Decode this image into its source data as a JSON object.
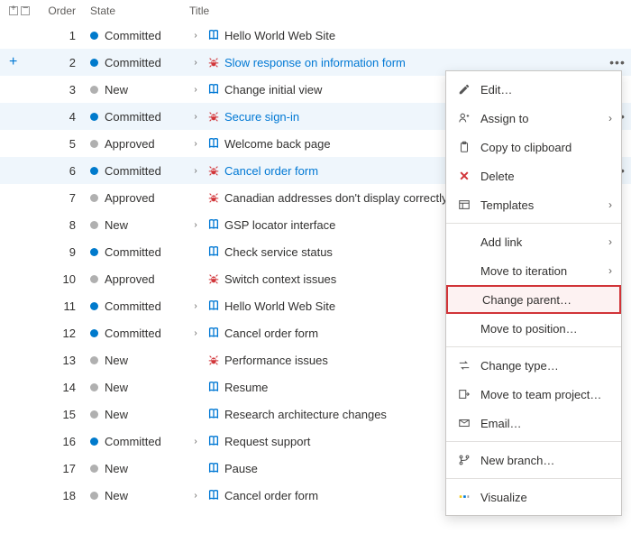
{
  "columns": {
    "order": "Order",
    "state": "State",
    "title": "Title"
  },
  "rows": [
    {
      "order": 1,
      "state": "Committed",
      "dot": "committed",
      "chev": true,
      "icon": "book",
      "title": "Hello World Web Site",
      "link": false,
      "sel": false,
      "dots": false
    },
    {
      "order": 2,
      "state": "Committed",
      "dot": "committed",
      "chev": true,
      "icon": "bug",
      "title": "Slow response on information form",
      "link": true,
      "sel": true,
      "dots": true,
      "add": true
    },
    {
      "order": 3,
      "state": "New",
      "dot": "new",
      "chev": true,
      "icon": "book",
      "title": "Change initial view",
      "link": false,
      "sel": false,
      "dots": false
    },
    {
      "order": 4,
      "state": "Committed",
      "dot": "committed",
      "chev": true,
      "icon": "bug",
      "title": "Secure sign-in",
      "link": true,
      "sel": true,
      "dots": true
    },
    {
      "order": 5,
      "state": "Approved",
      "dot": "approved",
      "chev": true,
      "icon": "book",
      "title": "Welcome back page",
      "link": false,
      "sel": false,
      "dots": false
    },
    {
      "order": 6,
      "state": "Committed",
      "dot": "committed",
      "chev": true,
      "icon": "bug",
      "title": "Cancel order form",
      "link": true,
      "sel": true,
      "dots": true
    },
    {
      "order": 7,
      "state": "Approved",
      "dot": "approved",
      "chev": false,
      "icon": "bug",
      "title": "Canadian addresses don't display correctly",
      "link": false,
      "sel": false,
      "dots": false
    },
    {
      "order": 8,
      "state": "New",
      "dot": "new",
      "chev": true,
      "icon": "book",
      "title": "GSP locator interface",
      "link": false,
      "sel": false,
      "dots": false
    },
    {
      "order": 9,
      "state": "Committed",
      "dot": "committed",
      "chev": false,
      "icon": "book",
      "title": "Check service status",
      "link": false,
      "sel": false,
      "dots": false
    },
    {
      "order": 10,
      "state": "Approved",
      "dot": "approved",
      "chev": false,
      "icon": "bug",
      "title": "Switch context issues",
      "link": false,
      "sel": false,
      "dots": false
    },
    {
      "order": 11,
      "state": "Committed",
      "dot": "committed",
      "chev": true,
      "icon": "book",
      "title": "Hello World Web Site",
      "link": false,
      "sel": false,
      "dots": false
    },
    {
      "order": 12,
      "state": "Committed",
      "dot": "committed",
      "chev": true,
      "icon": "book",
      "title": "Cancel order form",
      "link": false,
      "sel": false,
      "dots": false
    },
    {
      "order": 13,
      "state": "New",
      "dot": "new",
      "chev": false,
      "icon": "bug",
      "title": "Performance issues",
      "link": false,
      "sel": false,
      "dots": false
    },
    {
      "order": 14,
      "state": "New",
      "dot": "new",
      "chev": false,
      "icon": "book",
      "title": "Resume",
      "link": false,
      "sel": false,
      "dots": false
    },
    {
      "order": 15,
      "state": "New",
      "dot": "new",
      "chev": false,
      "icon": "book",
      "title": "Research architecture changes",
      "link": false,
      "sel": false,
      "dots": false
    },
    {
      "order": 16,
      "state": "Committed",
      "dot": "committed",
      "chev": true,
      "icon": "book",
      "title": "Request support",
      "link": false,
      "sel": false,
      "dots": false
    },
    {
      "order": 17,
      "state": "New",
      "dot": "new",
      "chev": false,
      "icon": "book",
      "title": "Pause",
      "link": false,
      "sel": false,
      "dots": false
    },
    {
      "order": 18,
      "state": "New",
      "dot": "new",
      "chev": true,
      "icon": "book",
      "title": "Cancel order form",
      "link": false,
      "sel": false,
      "dots": false
    }
  ],
  "menu": {
    "edit": "Edit…",
    "assign": "Assign to",
    "copy": "Copy to clipboard",
    "delete": "Delete",
    "templates": "Templates",
    "addlink": "Add link",
    "moveiter": "Move to iteration",
    "changeparent": "Change parent…",
    "movepos": "Move to position…",
    "changetype": "Change type…",
    "moveteam": "Move to team project…",
    "email": "Email…",
    "newbranch": "New branch…",
    "visualize": "Visualize"
  }
}
